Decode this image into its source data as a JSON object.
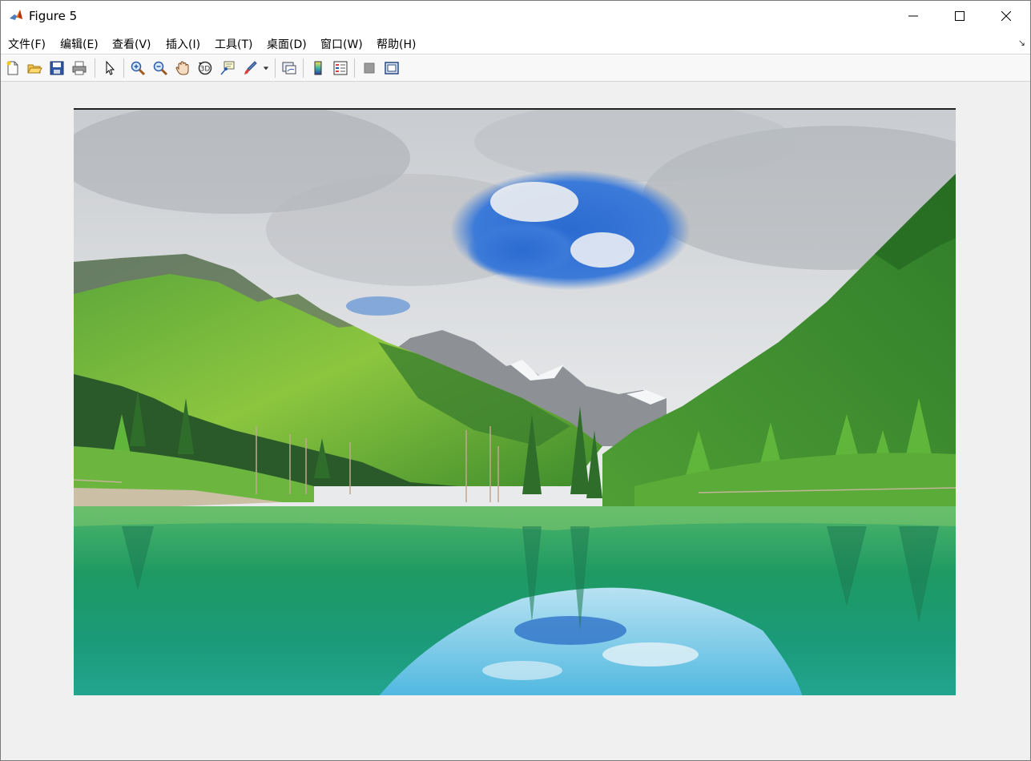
{
  "window": {
    "title": "Figure 5",
    "icon": "matlab-icon"
  },
  "controls": {
    "minimize": "minimize-icon",
    "maximize": "maximize-icon",
    "close": "close-icon"
  },
  "menu": [
    {
      "label": "文件(F)"
    },
    {
      "label": "编辑(E)"
    },
    {
      "label": "查看(V)"
    },
    {
      "label": "插入(I)"
    },
    {
      "label": "工具(T)"
    },
    {
      "label": "桌面(D)"
    },
    {
      "label": "窗口(W)"
    },
    {
      "label": "帮助(H)"
    }
  ],
  "toolbar": [
    "new-figure-icon",
    "open-icon",
    "save-icon",
    "print-icon",
    "pointer-icon",
    "zoom-in-icon",
    "zoom-out-icon",
    "pan-icon",
    "rotate-3d-icon",
    "data-cursor-icon",
    "brush-icon",
    "link-plot-icon",
    "colorbar-icon",
    "legend-icon",
    "hide-plot-tools-icon",
    "show-plot-tools-icon"
  ],
  "figure": {
    "content": "landscape photo: mountains, cloudy sky, forest and lake reflection"
  }
}
